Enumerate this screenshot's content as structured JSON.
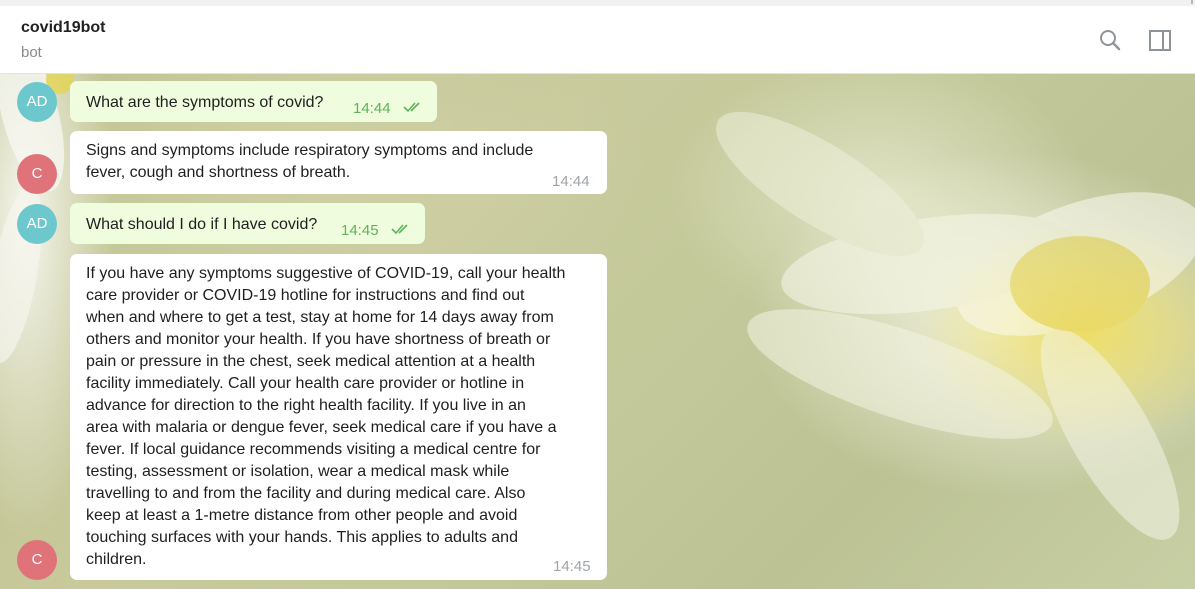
{
  "header": {
    "title": "covid19bot",
    "status": "bot",
    "search_icon": "search-icon",
    "side_panel_icon": "side-panel-icon"
  },
  "theme": {
    "accent": "#5fb25a",
    "outgoing_bubble": "#effdde",
    "incoming_bubble": "#ffffff"
  },
  "messages": [
    {
      "sender": "AD",
      "direction": "outgoing",
      "text": "What are the symptoms of covid?",
      "time": "14:44",
      "status": "read"
    },
    {
      "sender": "C",
      "direction": "incoming",
      "text": "Signs and symptoms include respiratory symptoms and include\nfever, cough and shortness of breath.",
      "time": "14:44"
    },
    {
      "sender": "AD",
      "direction": "outgoing",
      "text": "What should I do if I have covid?",
      "time": "14:45",
      "status": "read"
    },
    {
      "sender": "C",
      "direction": "incoming",
      "text": "If you have any symptoms suggestive of COVID-19, call your health\ncare provider or COVID-19 hotline for instructions and find out\nwhen and where to get a test, stay at home for 14 days away from\nothers and monitor your health. If you have shortness of breath or\npain or pressure in the chest, seek medical attention at a health\nfacility immediately. Call your health care provider or hotline in\nadvance for direction to the right health facility. If you live in an\narea with malaria or dengue fever, seek medical care if you have a\nfever. If local guidance recommends visiting a medical centre for\ntesting, assessment or isolation, wear a medical mask while\ntravelling to and from the facility and during medical care. Also\nkeep at least a 1-metre distance from other people and avoid\ntouching surfaces with your hands.  This applies to adults and\nchildren.",
      "time": "14:45"
    }
  ]
}
